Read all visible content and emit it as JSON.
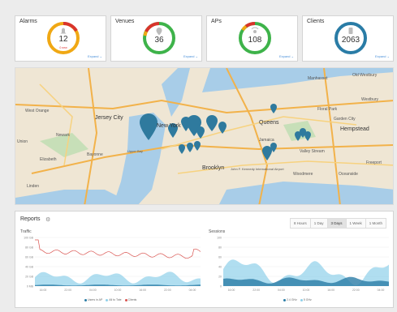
{
  "cards": [
    {
      "title": "Alarms",
      "value": "12",
      "sub": "0 new",
      "expand": "Expand"
    },
    {
      "title": "Venues",
      "value": "36",
      "expand": "Expand"
    },
    {
      "title": "APs",
      "value": "108",
      "expand": "Expand"
    },
    {
      "title": "Clients",
      "value": "2063",
      "expand": "Expand"
    }
  ],
  "map": {
    "labels": [
      "West Orange",
      "Jersey City",
      "Bayonne",
      "Elizabeth",
      "Linden",
      "Union",
      "Newark",
      "New York",
      "Brooklyn",
      "Queens",
      "Manhasset",
      "Westbury",
      "Hempstead",
      "Garden City",
      "Valley Stream",
      "Freeport",
      "Oceanside",
      "Woodmere",
      "Jamaica",
      "John F. Kennedy International Airport",
      "Old Westbury",
      "Floral Park",
      "Upper Bay"
    ]
  },
  "reports": {
    "title": "Reports",
    "tabs": [
      "8 Hours",
      "1 Day",
      "3 Days",
      "1 Week",
      "1 Month"
    ],
    "traffic": {
      "title": "Traffic",
      "yticks": [
        "100 GB",
        "80 GB",
        "60 GB",
        "40 GB",
        "20 GB",
        "0 MB"
      ],
      "xticks": [
        "16:00",
        "22:00",
        "04:00",
        "10:00",
        "16:00",
        "22:00",
        "04:00"
      ],
      "legend": [
        "Users in AP",
        "All to Tote",
        "Clients"
      ]
    },
    "sessions": {
      "title": "Sessions",
      "yticks": [
        "100",
        "80",
        "60",
        "40",
        "20",
        "0"
      ],
      "xticks": [
        "16:00",
        "22:00",
        "04:00",
        "10:00",
        "16:00",
        "22:00",
        "04:00"
      ],
      "legend": [
        "2.4 GHz",
        "5 GHz"
      ]
    }
  },
  "colors": {
    "accent": "#4a90d9",
    "ok": "#3eb34a",
    "warn": "#f0a814",
    "bad": "#d9342b",
    "blue": "#2a7ca6",
    "pin": "#2f7a9e"
  }
}
